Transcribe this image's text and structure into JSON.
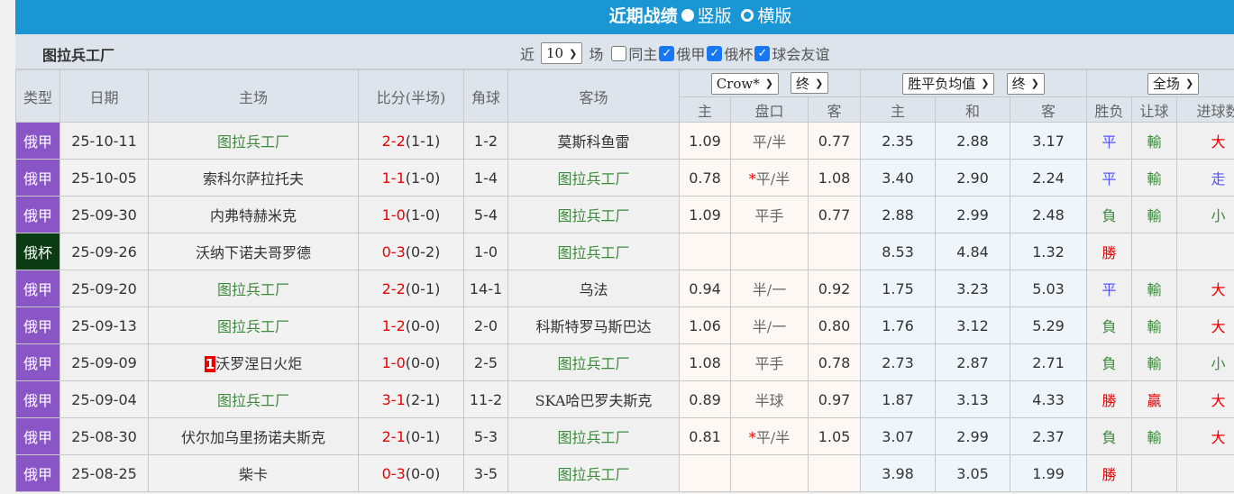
{
  "header": {
    "title": "近期战绩",
    "opt1": "竖版",
    "opt2": "横版",
    "selected": "竖版"
  },
  "filter": {
    "team": "图拉兵工厂",
    "prefix": "近",
    "count": "10",
    "suffix": "场",
    "checks": [
      {
        "label": "同主",
        "checked": false
      },
      {
        "label": "俄甲",
        "checked": true
      },
      {
        "label": "俄杯",
        "checked": true
      },
      {
        "label": "球会友谊",
        "checked": true
      }
    ]
  },
  "selects": {
    "company": "Crow*",
    "hc_stage": "终",
    "euro_type": "胜平负均值",
    "euro_stage": "终",
    "period": "全场"
  },
  "columns": {
    "type": "类型",
    "date": "日期",
    "home": "主场",
    "score": "比分(半场)",
    "corner": "角球",
    "away": "客场",
    "hc_home": "主",
    "hc_line": "盘口",
    "hc_away": "客",
    "eu_home": "主",
    "eu_draw": "和",
    "eu_away": "客",
    "result": "胜负",
    "handicap": "让球",
    "goals": "进球数"
  },
  "colors": {
    "header": "#1a96d4",
    "league": "#8a55c5",
    "cup": "#0b3b12",
    "win": "#e00000",
    "draw": "#5555ff",
    "loss": "#3d8a3d"
  },
  "rows": [
    {
      "type": "俄甲",
      "date": "25-10-11",
      "home": "图拉兵工厂",
      "home_rank": "",
      "score": "2-2",
      "half": "(1-1)",
      "corner": "1-2",
      "away": "莫斯科鱼雷",
      "hh": "1.09",
      "hl": "平/半",
      "hstar": false,
      "ha": "0.77",
      "eh": "2.35",
      "ed": "2.88",
      "ea": "3.17",
      "res": "平",
      "hcr": "輸",
      "goals": "大"
    },
    {
      "type": "俄甲",
      "date": "25-10-05",
      "home": "索科尔萨拉托夫",
      "home_rank": "",
      "score": "1-1",
      "half": "(1-0)",
      "corner": "1-4",
      "away": "图拉兵工厂",
      "hh": "0.78",
      "hl": "平/半",
      "hstar": true,
      "ha": "1.08",
      "eh": "3.40",
      "ed": "2.90",
      "ea": "2.24",
      "res": "平",
      "hcr": "輸",
      "goals": "走"
    },
    {
      "type": "俄甲",
      "date": "25-09-30",
      "home": "内弗特赫米克",
      "home_rank": "",
      "score": "1-0",
      "half": "(1-0)",
      "corner": "5-4",
      "away": "图拉兵工厂",
      "hh": "1.09",
      "hl": "平手",
      "hstar": false,
      "ha": "0.77",
      "eh": "2.88",
      "ed": "2.99",
      "ea": "2.48",
      "res": "負",
      "hcr": "輸",
      "goals": "小"
    },
    {
      "type": "俄杯",
      "date": "25-09-26",
      "home": "沃纳下诺夫哥罗德",
      "home_rank": "",
      "score": "0-3",
      "half": "(0-2)",
      "corner": "1-0",
      "away": "图拉兵工厂",
      "hh": "",
      "hl": "",
      "hstar": false,
      "ha": "",
      "eh": "8.53",
      "ed": "4.84",
      "ea": "1.32",
      "res": "勝",
      "hcr": "",
      "goals": ""
    },
    {
      "type": "俄甲",
      "date": "25-09-20",
      "home": "图拉兵工厂",
      "home_rank": "",
      "score": "2-2",
      "half": "(0-1)",
      "corner": "14-1",
      "away": "乌法",
      "hh": "0.94",
      "hl": "半/一",
      "hstar": false,
      "ha": "0.92",
      "eh": "1.75",
      "ed": "3.23",
      "ea": "5.03",
      "res": "平",
      "hcr": "輸",
      "goals": "大"
    },
    {
      "type": "俄甲",
      "date": "25-09-13",
      "home": "图拉兵工厂",
      "home_rank": "",
      "score": "1-2",
      "half": "(0-0)",
      "corner": "2-0",
      "away": "科斯特罗马斯巴达",
      "hh": "1.06",
      "hl": "半/一",
      "hstar": false,
      "ha": "0.80",
      "eh": "1.76",
      "ed": "3.12",
      "ea": "5.29",
      "res": "負",
      "hcr": "輸",
      "goals": "大"
    },
    {
      "type": "俄甲",
      "date": "25-09-09",
      "home": "沃罗涅日火炬",
      "home_rank": "1",
      "score": "1-0",
      "half": "(0-0)",
      "corner": "2-5",
      "away": "图拉兵工厂",
      "hh": "1.08",
      "hl": "平手",
      "hstar": false,
      "ha": "0.78",
      "eh": "2.73",
      "ed": "2.87",
      "ea": "2.71",
      "res": "負",
      "hcr": "輸",
      "goals": "小"
    },
    {
      "type": "俄甲",
      "date": "25-09-04",
      "home": "图拉兵工厂",
      "home_rank": "",
      "score": "3-1",
      "half": "(2-1)",
      "corner": "11-2",
      "away": "SKA哈巴罗夫斯克",
      "hh": "0.89",
      "hl": "半球",
      "hstar": false,
      "ha": "0.97",
      "eh": "1.87",
      "ed": "3.13",
      "ea": "4.33",
      "res": "勝",
      "hcr": "贏",
      "goals": "大"
    },
    {
      "type": "俄甲",
      "date": "25-08-30",
      "home": "伏尔加乌里扬诺夫斯克",
      "home_rank": "",
      "score": "2-1",
      "half": "(0-1)",
      "corner": "5-3",
      "away": "图拉兵工厂",
      "hh": "0.81",
      "hl": "平/半",
      "hstar": true,
      "ha": "1.05",
      "eh": "3.07",
      "ed": "2.99",
      "ea": "2.37",
      "res": "負",
      "hcr": "輸",
      "goals": "大"
    },
    {
      "type": "俄甲",
      "date": "25-08-25",
      "home": "柴卡",
      "home_rank": "",
      "score": "0-3",
      "half": "(0-0)",
      "corner": "3-5",
      "away": "图拉兵工厂",
      "hh": "",
      "hl": "",
      "hstar": false,
      "ha": "",
      "eh": "3.98",
      "ed": "3.05",
      "ea": "1.99",
      "res": "勝",
      "hcr": "",
      "goals": ""
    }
  ]
}
